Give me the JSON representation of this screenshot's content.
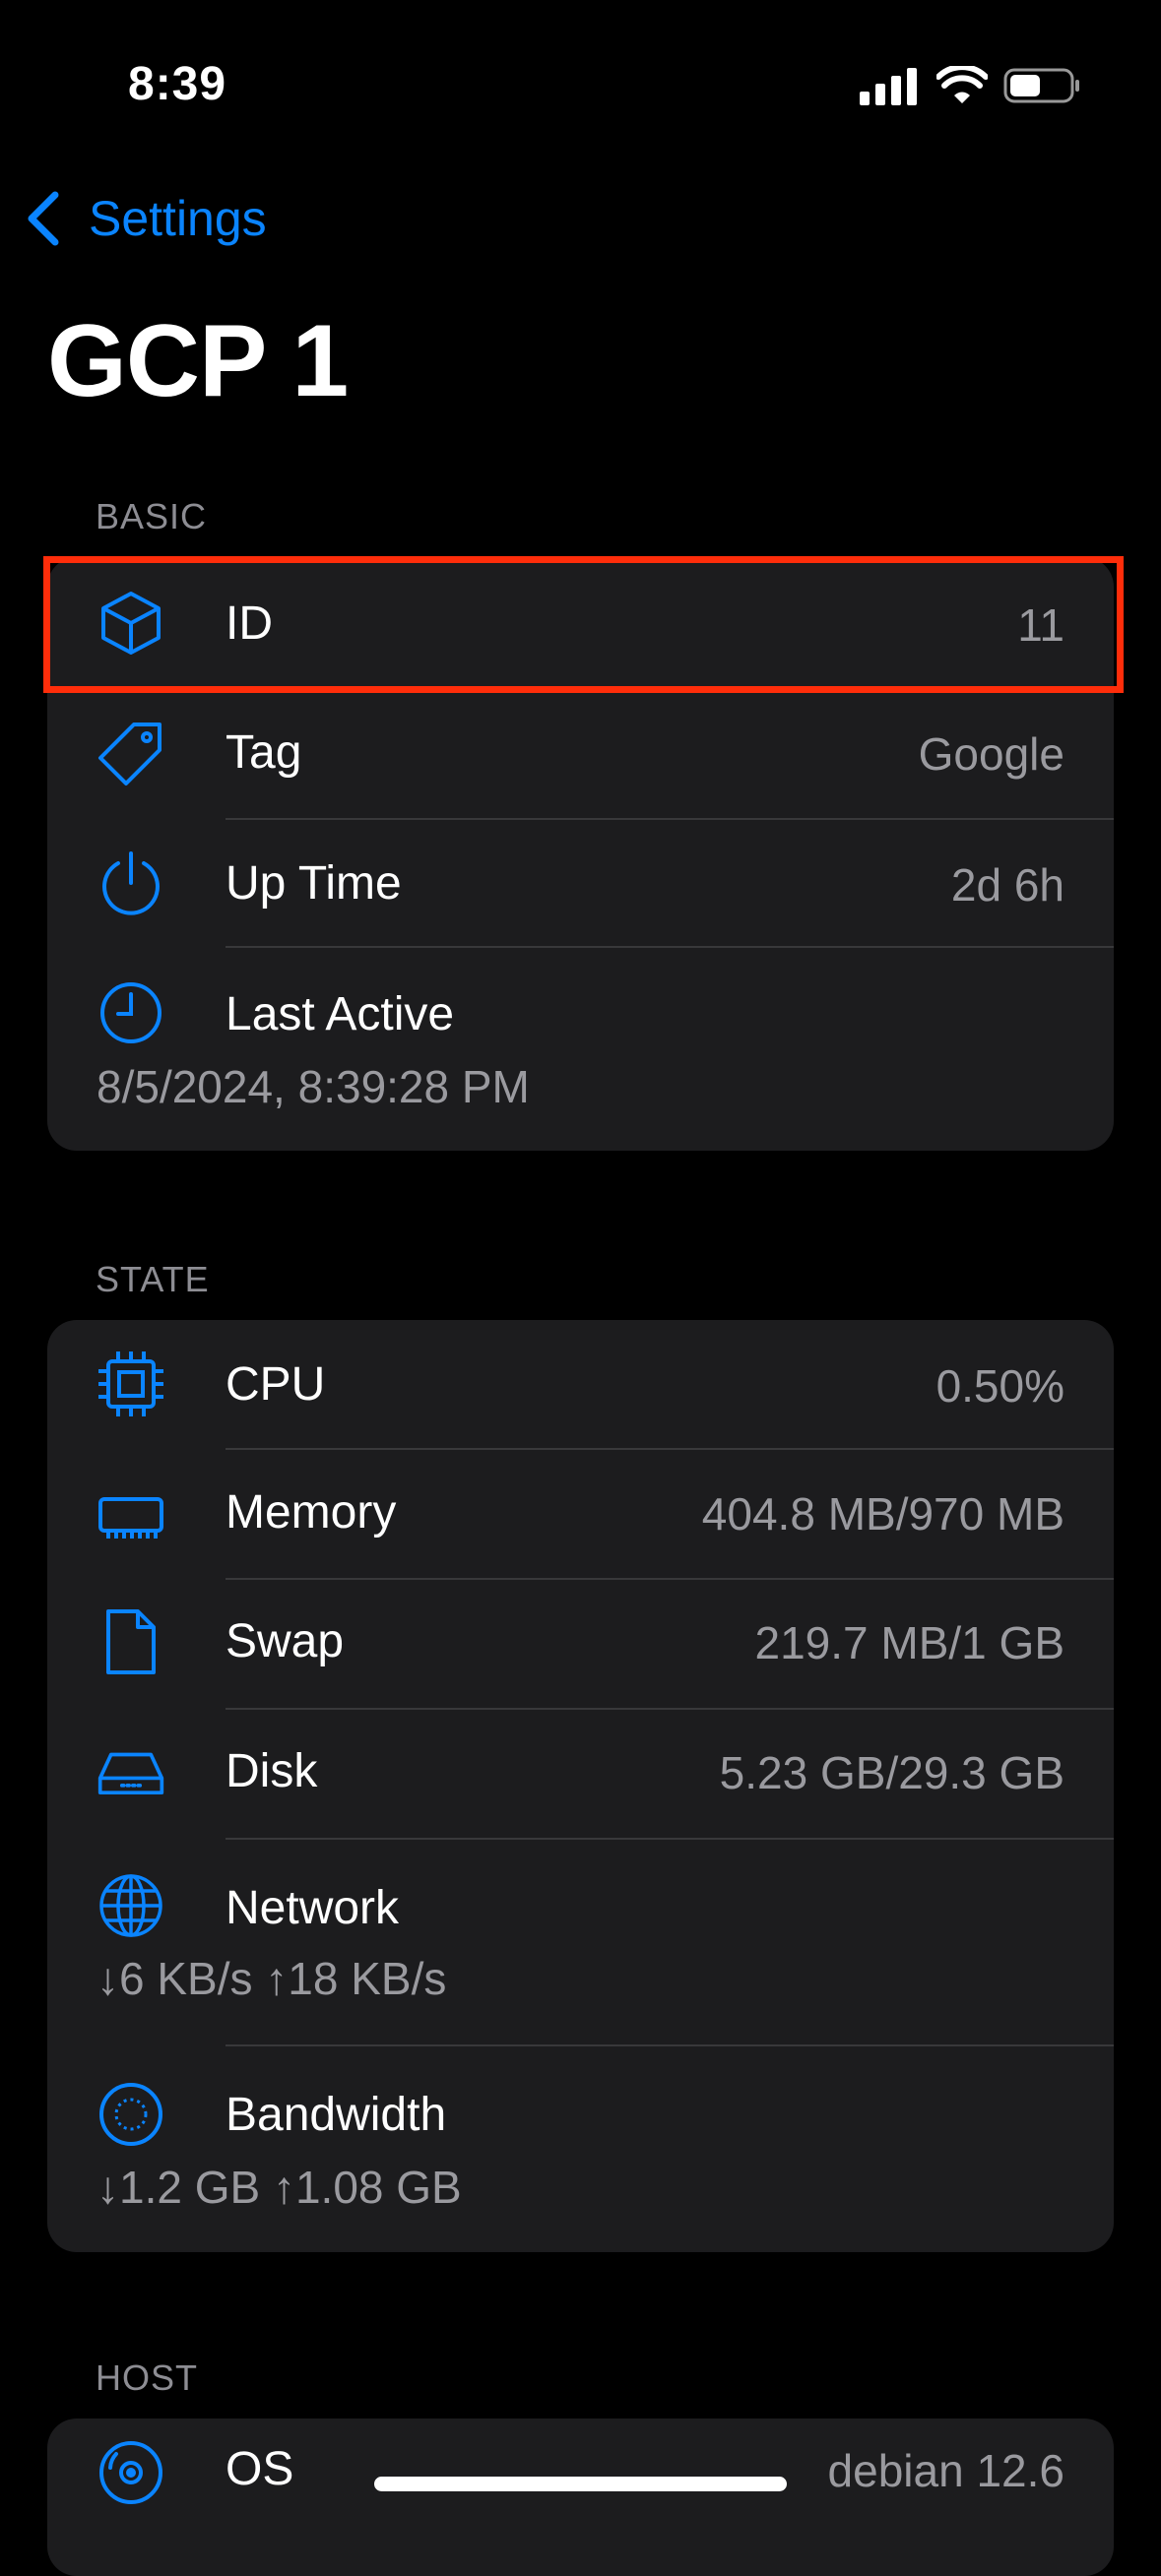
{
  "status_bar": {
    "time": "8:39"
  },
  "nav": {
    "back_label": "Settings",
    "title": "GCP 1"
  },
  "sections": {
    "basic": {
      "label": "BASIC",
      "rows": {
        "id": {
          "label": "ID",
          "value": "11",
          "icon": "cube-icon"
        },
        "tag": {
          "label": "Tag",
          "value": "Google",
          "icon": "tag-icon"
        },
        "uptime": {
          "label": "Up Time",
          "value": "2d 6h",
          "icon": "power-icon"
        },
        "last_active": {
          "label": "Last Active",
          "value": "8/5/2024, 8:39:28 PM",
          "icon": "clock-icon"
        }
      }
    },
    "state": {
      "label": "STATE",
      "rows": {
        "cpu": {
          "label": "CPU",
          "value": "0.50%",
          "icon": "cpu-icon"
        },
        "memory": {
          "label": "Memory",
          "value": "404.8 MB/970 MB",
          "icon": "memory-icon"
        },
        "swap": {
          "label": "Swap",
          "value": "219.7 MB/1 GB",
          "icon": "document-icon"
        },
        "disk": {
          "label": "Disk",
          "value": "5.23 GB/29.3 GB",
          "icon": "disk-icon"
        },
        "network": {
          "label": "Network",
          "value": "↓6 KB/s ↑18 KB/s",
          "icon": "globe-icon"
        },
        "bandwidth": {
          "label": "Bandwidth",
          "value": "↓1.2 GB ↑1.08 GB",
          "icon": "bandwidth-icon"
        }
      }
    },
    "host": {
      "label": "HOST",
      "rows": {
        "os": {
          "label": "OS",
          "value": "debian 12.6",
          "icon": "disc-icon"
        }
      }
    }
  },
  "colors": {
    "accent": "#0a84ff",
    "highlight": "#ff2d0a",
    "card": "#1c1c1e"
  }
}
